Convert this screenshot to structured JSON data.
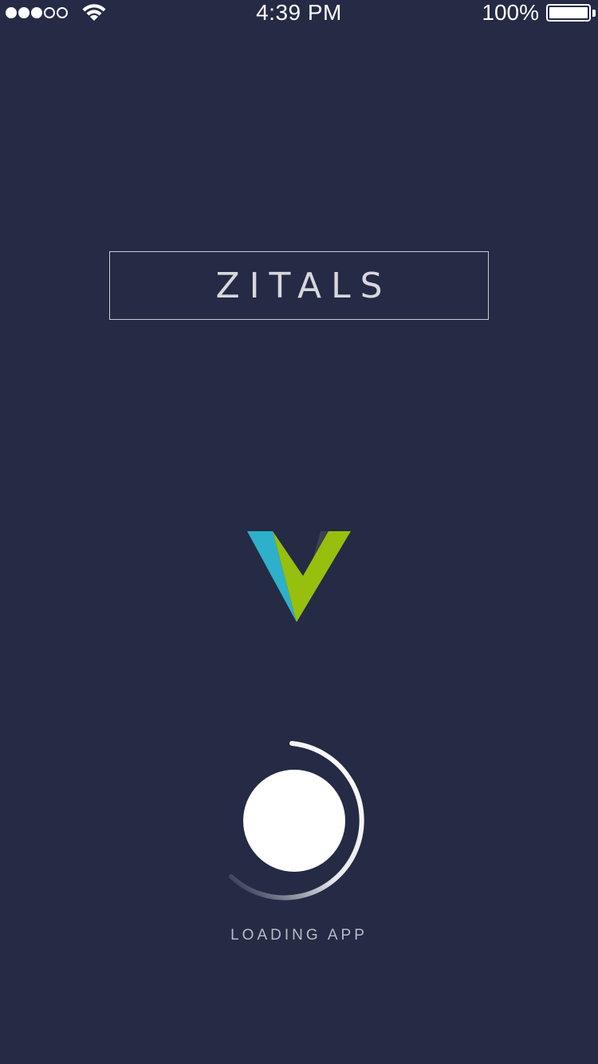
{
  "status_bar": {
    "signal_bars_filled": 3,
    "signal_bars_total": 5,
    "time": "4:39 PM",
    "battery_percent": "100%",
    "battery_level": 1.0
  },
  "brand": {
    "name": "ZITALS"
  },
  "logo": {
    "icon": "v-logo-icon",
    "colors": {
      "left_blade": "#2eb0cb",
      "right_blade": "#97bf0d",
      "shadow": "#3d4150"
    }
  },
  "loader": {
    "label": "LOADING APP"
  },
  "colors": {
    "background": "#252a45",
    "text": "#ffffff",
    "muted_text": "#b9bcc8"
  }
}
